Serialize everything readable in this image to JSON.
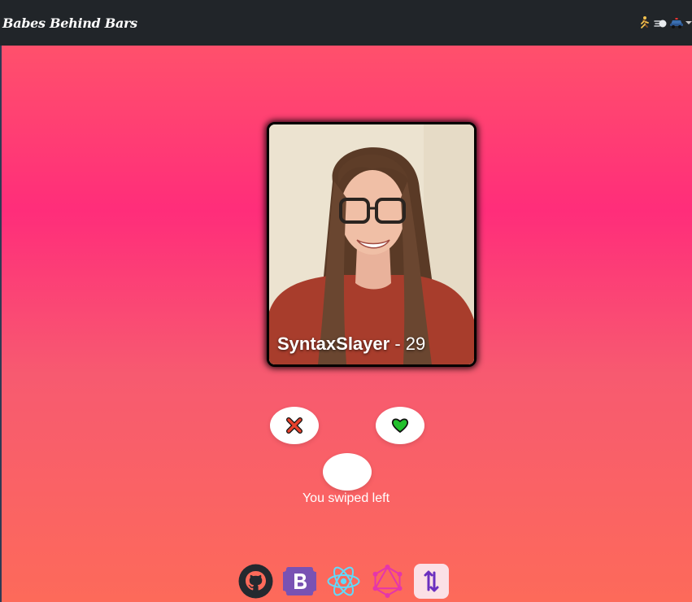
{
  "navbar": {
    "brand": "Babes Behind Bars",
    "icons": [
      "running-person-icon",
      "dash-icon",
      "police-car-icon",
      "dropdown-caret-icon"
    ]
  },
  "profile": {
    "name": "SyntaxSlayer",
    "separator": " - ",
    "age": "29"
  },
  "actions": {
    "dislike_icon": "cross-mark-icon",
    "like_icon": "green-heart-icon",
    "undo_icon": "blank"
  },
  "status": {
    "message": "You swiped left"
  },
  "footer": {
    "icons": [
      "github-icon",
      "bootstrap-icon",
      "react-icon",
      "graphql-icon",
      "apollo-icon"
    ]
  },
  "colors": {
    "navbar_bg": "#212529",
    "gradient_top": "#ff5a68",
    "gradient_mid": "#ff2d7a",
    "gradient_bottom": "#fd6a5a",
    "like_green": "#22c02c",
    "dislike_red": "#e8412c"
  }
}
